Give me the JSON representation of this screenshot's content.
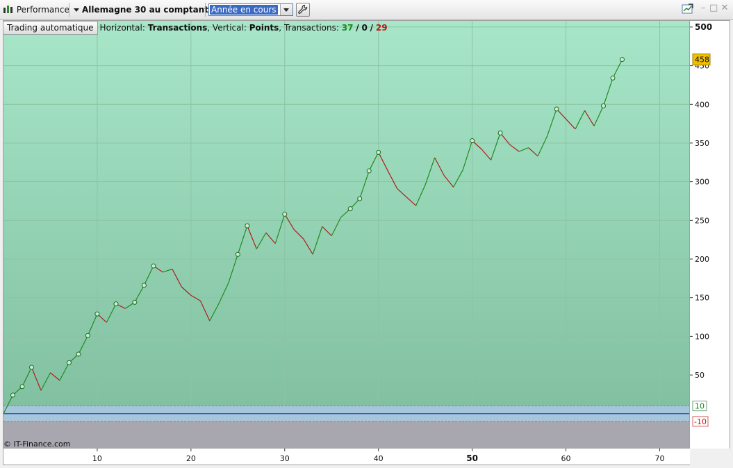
{
  "toolbar": {
    "performance_label": "Performance",
    "instrument_label": "Allemagne 30 au comptant (-)",
    "period_selected": "Année en cours",
    "wrench_icon": "wrench-icon",
    "performance_icon": "bar-chart-icon",
    "window_icons": [
      "refresh-chart-icon",
      "minimize-icon",
      "maximize-icon",
      "close-icon"
    ]
  },
  "legend": {
    "auto_button": "Trading automatique",
    "horizontal_label": "Horizontal:",
    "horizontal_value": "Transactions",
    "sep1": ",",
    "vertical_label": "Vertical:",
    "vertical_value": "Points",
    "sep2": ",",
    "transactions_label": "Transactions:",
    "wins": "37",
    "slash1": "/",
    "neutral": "0",
    "slash2": "/",
    "losses": "29"
  },
  "copyright": "© IT-Finance.com",
  "chart_data": {
    "type": "line",
    "xlabel": "",
    "ylabel": "",
    "xlim": [
      0,
      73.3
    ],
    "ylim": [
      -46,
      508
    ],
    "x_ticks": [
      10,
      20,
      30,
      40,
      50,
      60,
      70
    ],
    "x_tick_bold": 50,
    "y_ticks": [
      50,
      100,
      150,
      200,
      250,
      300,
      350,
      400,
      450,
      500
    ],
    "current_value_label": "458",
    "upper_band": 10,
    "upper_band_label": "10",
    "lower_band": -10,
    "lower_band_label": "-10",
    "grid": true,
    "colors": {
      "up": "#1f8a1f",
      "down": "#b01c1c",
      "zero_line": "#2a4ab0",
      "badge": "#f0c000"
    },
    "x": [
      0,
      1,
      2,
      3,
      4,
      5,
      6,
      7,
      8,
      9,
      10,
      11,
      12,
      13,
      14,
      15,
      16,
      17,
      18,
      19,
      20,
      21,
      22,
      23,
      24,
      25,
      26,
      27,
      28,
      29,
      30,
      31,
      32,
      33,
      34,
      35,
      36,
      37,
      38,
      39,
      40,
      41,
      42,
      43,
      44,
      45,
      46,
      47,
      48,
      49,
      50,
      51,
      52,
      53,
      54,
      55,
      56,
      57,
      58,
      59,
      60,
      61,
      62,
      63,
      64,
      65,
      66
    ],
    "y": [
      0,
      24,
      35,
      60,
      30,
      53,
      43,
      66,
      77,
      101,
      129,
      118,
      142,
      136,
      144,
      166,
      191,
      183,
      187,
      164,
      153,
      146,
      120,
      143,
      169,
      206,
      243,
      213,
      234,
      220,
      258,
      238,
      226,
      206,
      242,
      230,
      254,
      265,
      278,
      314,
      338,
      314,
      291,
      280,
      269,
      296,
      331,
      308,
      293,
      315,
      353,
      342,
      328,
      363,
      348,
      339,
      344,
      333,
      359,
      394,
      381,
      368,
      392,
      372,
      398,
      434,
      458
    ],
    "markers_at": [
      1,
      2,
      3,
      7,
      8,
      9,
      10,
      12,
      14,
      15,
      16,
      25,
      26,
      30,
      37,
      38,
      39,
      40,
      50,
      53,
      59,
      64,
      65,
      66
    ]
  }
}
